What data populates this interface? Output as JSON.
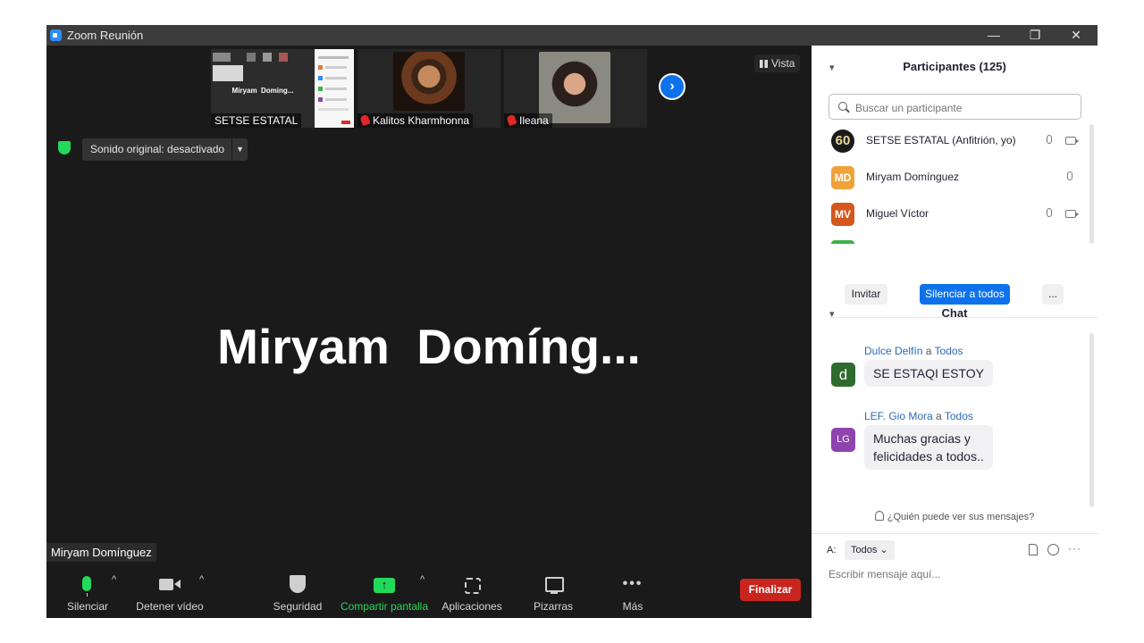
{
  "window": {
    "title": "Zoom Reunión",
    "minimize": "—",
    "restore": "❐",
    "close": "✕"
  },
  "thumbnails": [
    {
      "name": "SETSE ESTATAL",
      "muted": false,
      "screen_text": "Miryam  Doming..."
    },
    {
      "name": "Kalitos Kharmhonna",
      "muted": true
    },
    {
      "name": "Ileana",
      "muted": true
    }
  ],
  "view_label": "Vista",
  "original_sound": "Sonido original: desactivado",
  "speaker_name": "Miryam  Domíng...",
  "speaker_label": "Miryam Domínguez",
  "toolbar": {
    "mute": "Silenciar",
    "stop_video": "Detener vídeo",
    "security": "Seguridad",
    "share": "Compartir pantalla",
    "apps": "Aplicaciones",
    "whiteboards": "Pizarras",
    "more": "Más",
    "end": "Finalizar"
  },
  "participants": {
    "title": "Participantes (125)",
    "search_placeholder": "Buscar un participante",
    "list": [
      {
        "name": "SETSE ESTATAL (Anfitrión, yo)",
        "avatar": "60",
        "color": "#1a1a1a"
      },
      {
        "name": "Miryam Domínguez",
        "avatar": "MD",
        "color": "#f0a23a"
      },
      {
        "name": "Miguel Víctor",
        "avatar": "MV",
        "color": "#d4581c"
      }
    ],
    "invite": "Invitar",
    "mute_all": "Silenciar a todos",
    "more": "..."
  },
  "chat": {
    "title": "Chat",
    "messages": [
      {
        "sender": "Dulce Delfín",
        "to_word": "a",
        "to": "Todos",
        "avatar": "d",
        "color": "#2e6b2e",
        "text": "SE ESTAQI ESTOY"
      },
      {
        "sender": "LEF. Gio Mora",
        "to_word": "a",
        "to": "Todos",
        "avatar": "LG",
        "color": "#8e44ad",
        "text_line1": "Muchas gracias y",
        "text_line2": "felicidades a todos.."
      }
    ],
    "who_can_see": "¿Quién puede ver sus mensajes?",
    "to_label": "A:",
    "to_value": "Todos",
    "compose_placeholder": "Escribir mensaje aquí..."
  }
}
